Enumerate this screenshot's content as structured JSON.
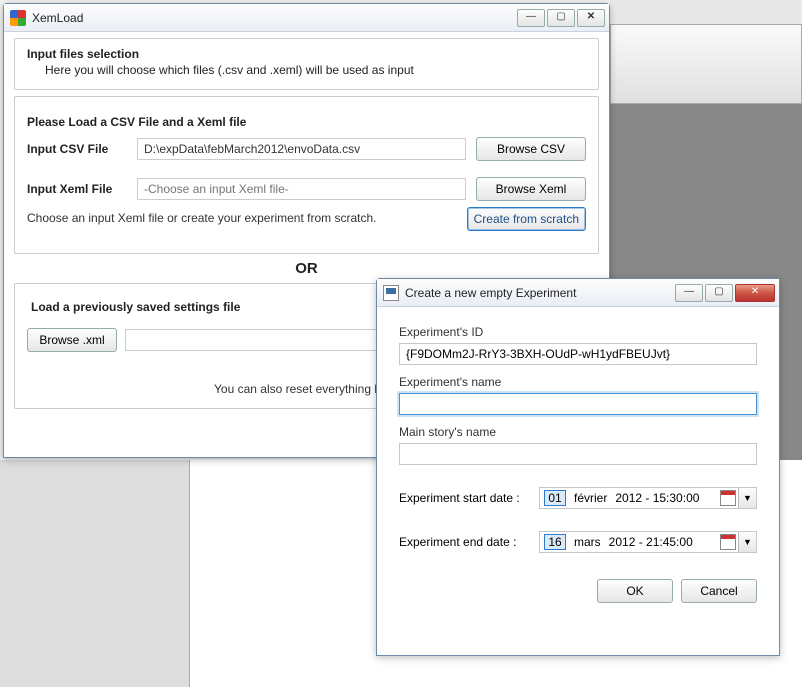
{
  "main": {
    "title": "XemLoad",
    "intro": {
      "title": "Input files selection",
      "subtitle": "Here you will choose which files (.csv and .xeml) will be used as input"
    },
    "section_head": "Please Load a CSV File and a Xeml file",
    "csv": {
      "label": "Input CSV File",
      "value": "D:\\expData\\febMarch2012\\envoData.csv",
      "browse": "Browse CSV"
    },
    "xeml": {
      "label": "Input Xeml File",
      "placeholder": "-Choose an input Xeml file-",
      "browse": "Browse Xeml",
      "hint": "Choose an input Xeml file or create your experiment from scratch.",
      "create": "Create from scratch"
    },
    "or": "OR",
    "settings_head": "Load a previously saved settings file",
    "browse_xml": "Browse .xml",
    "reset_note": "You can also reset everything by cl"
  },
  "modal": {
    "title": "Create a new empty Experiment",
    "id_label": "Experiment's ID",
    "id_value": "{F9DOMm2J-RrY3-3BXH-OUdP-wH1ydFBEUJvt}",
    "name_label": "Experiment's name",
    "name_value": "",
    "story_label": "Main story's name",
    "story_value": "",
    "start_label": "Experiment start date :",
    "start_day": "01",
    "start_month": "février",
    "start_rest": "2012 - 15:30:00",
    "end_label": "Experiment end date :",
    "end_day": "16",
    "end_month": "mars",
    "end_rest": "2012 - 21:45:00",
    "ok": "OK",
    "cancel": "Cancel"
  }
}
